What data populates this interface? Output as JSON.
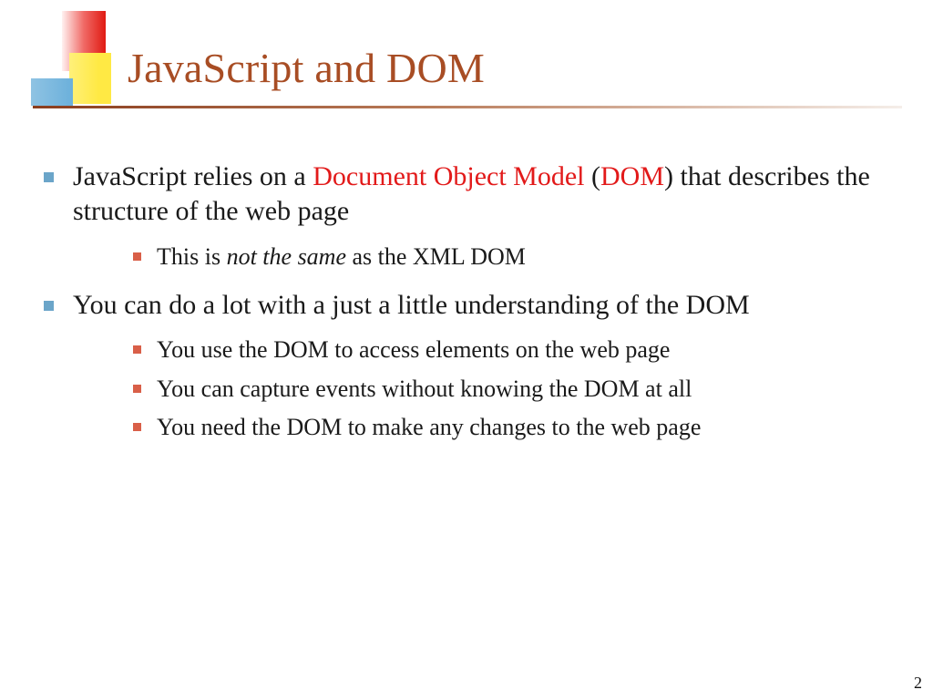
{
  "title": "JavaScript and DOM",
  "bullets": {
    "b1": {
      "pre": "JavaScript relies on a ",
      "hl1": "Document Object Model",
      "mid": " (",
      "hl2": "DOM",
      "post": ") that describes the structure of the web page",
      "sub": {
        "s1a": "This is ",
        "s1i": "not the same",
        "s1b": " as the XML DOM"
      }
    },
    "b2": {
      "text": "You can do a lot with a just a little understanding of the DOM",
      "sub": {
        "s1": "You use the DOM to access elements on the web page",
        "s2": "You can capture events without knowing the DOM at all",
        "s3": "You need the DOM to make any changes to the web page"
      }
    }
  },
  "page_number": "2"
}
